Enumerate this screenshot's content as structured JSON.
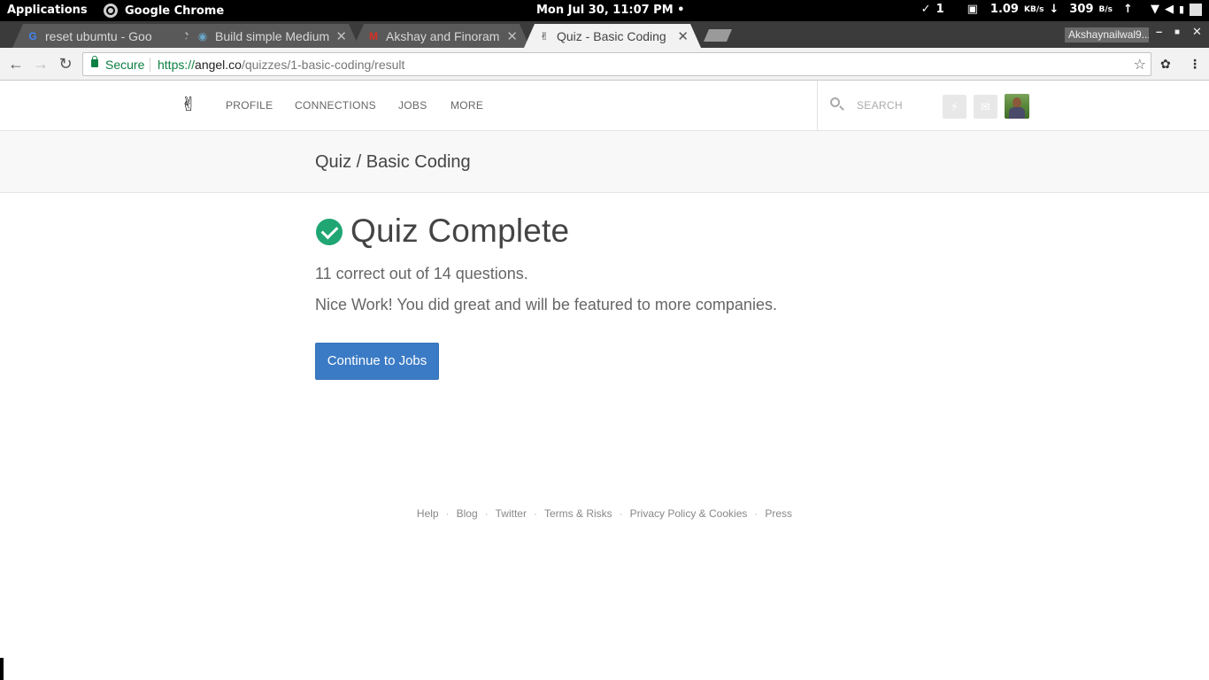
{
  "system_bar": {
    "applications": "Applications",
    "app_name": "Google Chrome",
    "clock": "Mon Jul 30, 11:07 PM •",
    "tasks_count": "1",
    "net_down_value": "1.09",
    "net_down_unit": "KB/s",
    "net_up_value": "309",
    "net_up_unit": "B/s"
  },
  "tabs": [
    {
      "title": "reset ubumtu - Goo",
      "favicon": "google-g-icon"
    },
    {
      "title": "Build simple Medium",
      "favicon": "eye-icon"
    },
    {
      "title": "Akshay and Finoram",
      "favicon": "gmail-icon"
    },
    {
      "title": "Quiz - Basic Coding",
      "favicon": "angellist-icon"
    }
  ],
  "profile_name": "Akshaynailwal9...",
  "address_bar": {
    "security_label": "Secure",
    "scheme": "https://",
    "host": "angel.co",
    "path": "/quizzes/1-basic-coding/result"
  },
  "site_nav": {
    "items": [
      "PROFILE",
      "CONNECTIONS",
      "JOBS",
      "MORE"
    ],
    "search_placeholder": "SEARCH"
  },
  "page": {
    "breadcrumb": "Quiz / Basic Coding",
    "heading": "Quiz Complete",
    "score_text": "11 correct out of 14 questions.",
    "praise_text": "Nice Work! You did great and will be featured to more companies.",
    "cta_label": "Continue to Jobs"
  },
  "quiz_result": {
    "correct": 11,
    "total": 14
  },
  "footer_links": [
    "Help",
    "Blog",
    "Twitter",
    "Terms & Risks",
    "Privacy Policy & Cookies",
    "Press"
  ],
  "colors": {
    "success_green": "#1fa672",
    "primary_blue": "#3b7bc5",
    "secure_green": "#0b8043"
  }
}
